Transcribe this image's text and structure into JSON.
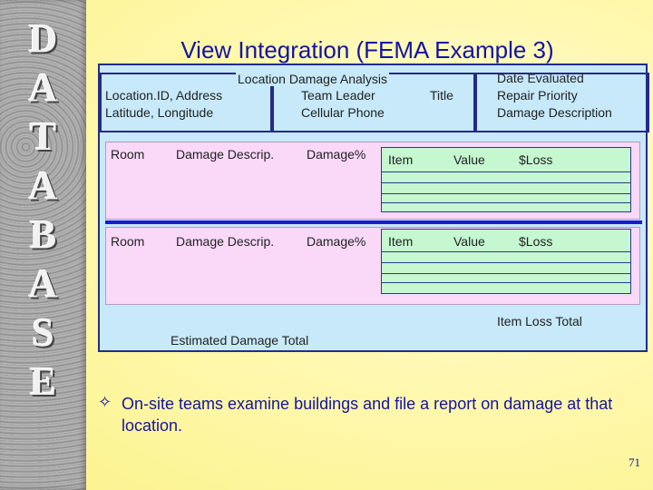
{
  "sidebar": {
    "letters": [
      "D",
      "A",
      "T",
      "A",
      "B",
      "A",
      "S",
      "E"
    ]
  },
  "slide": {
    "title": "View Integration (FEMA Example 3)",
    "page_number": "71"
  },
  "form": {
    "heading": "Location Damage Analysis",
    "left": {
      "line1": "Location.ID,   Address",
      "line2": "Latitude, Longitude"
    },
    "middle": {
      "line1": "Team Leader",
      "line2": "Cellular Phone",
      "title": "Title"
    },
    "right": {
      "line1": "Date Evaluated",
      "line2": "Repair Priority",
      "line3": "Damage Description"
    },
    "sections": [
      {
        "room": "Room",
        "damage_descrip": "Damage Descrip.",
        "damage_pct": "Damage%",
        "item": "Item",
        "value": "Value",
        "loss": "$Loss"
      },
      {
        "room": "Room",
        "damage_descrip": "Damage Descrip.",
        "damage_pct": "Damage%",
        "item": "Item",
        "value": "Value",
        "loss": "$Loss"
      }
    ],
    "item_loss_total": "Item Loss Total",
    "estimated_damage_total": "Estimated Damage Total"
  },
  "bullet": {
    "glyph": "✧",
    "text": "On-site teams examine buildings and file a report on damage at that location."
  }
}
